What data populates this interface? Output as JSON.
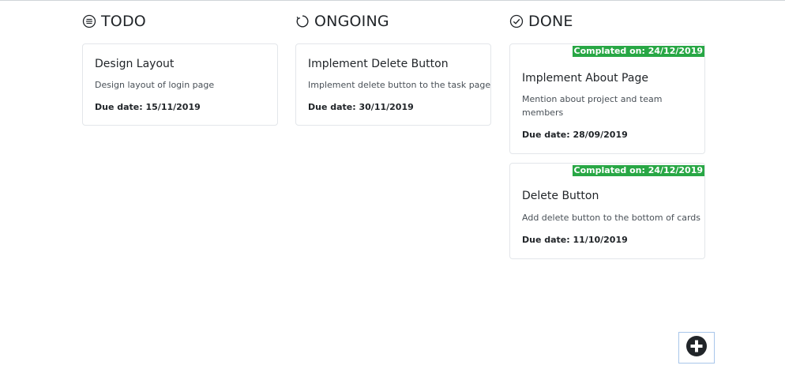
{
  "columns": {
    "todo": {
      "title": "TODO",
      "icon": "list-circle-icon",
      "cards": [
        {
          "title": "Design Layout",
          "description": "Design layout of login page",
          "due": "Due date: 15/11/2019"
        }
      ]
    },
    "ongoing": {
      "title": "ONGOING",
      "icon": "refresh-icon",
      "cards": [
        {
          "title": "Implement Delete Button",
          "description": "Implement delete button to the task page",
          "due": "Due date: 30/11/2019"
        }
      ]
    },
    "done": {
      "title": "DONE",
      "icon": "check-circle-icon",
      "cards": [
        {
          "completed": "Complated on: 24/12/2019",
          "title": "Implement About Page",
          "description": "Mention about project and team members",
          "due": "Due date: 28/09/2019"
        },
        {
          "completed": "Complated on: 24/12/2019",
          "title": "Delete Button",
          "description": "Add delete button to the bottom of cards",
          "due": "Due date: 11/10/2019"
        }
      ]
    }
  },
  "fab": {
    "icon": "plus-circle-icon"
  },
  "colors": {
    "completed_badge": "#28a745",
    "text": "#212529"
  }
}
